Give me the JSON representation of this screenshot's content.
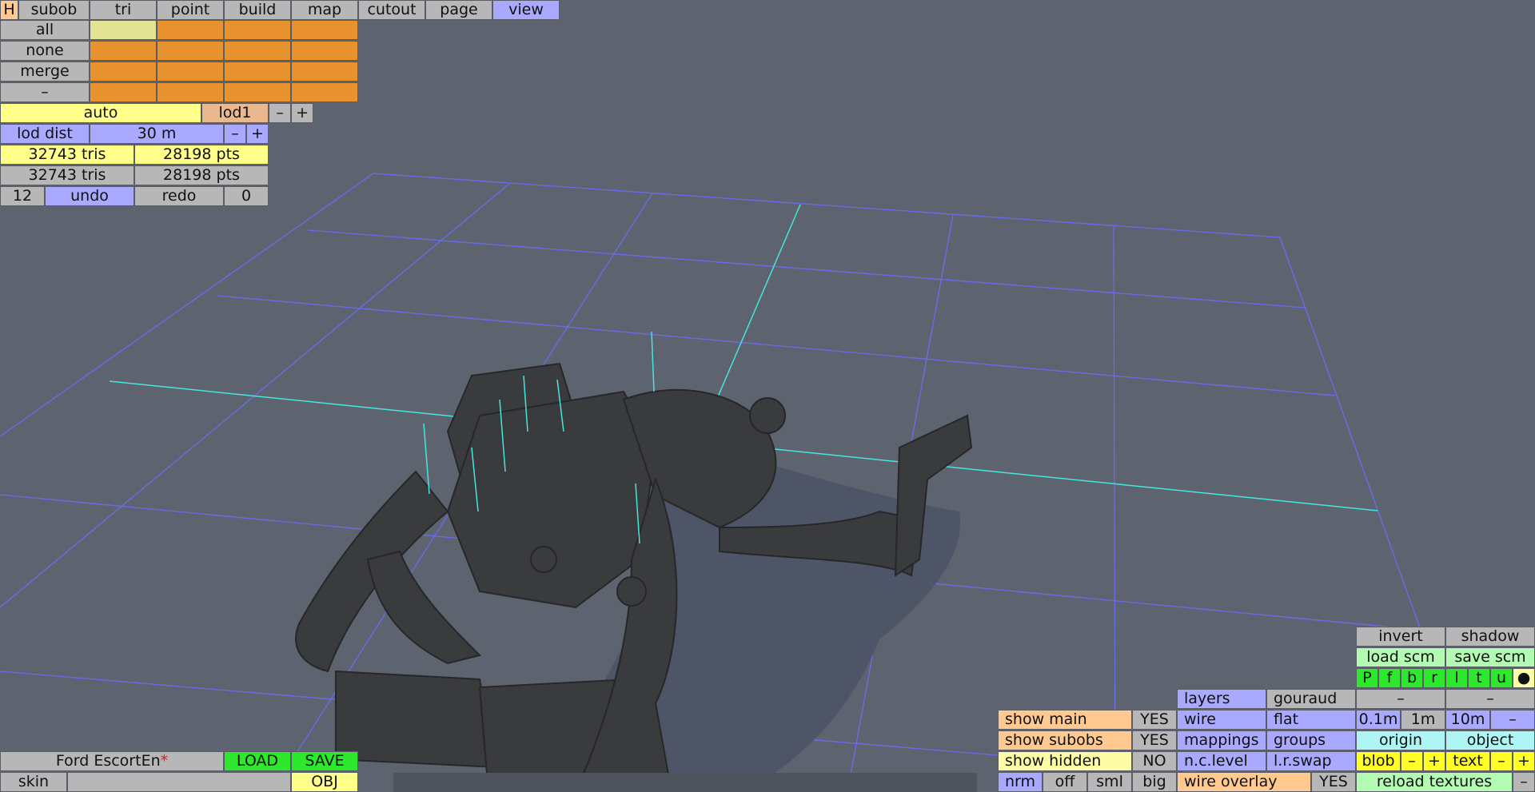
{
  "menu": {
    "home": "H",
    "tabs": [
      "subob",
      "tri",
      "point",
      "build",
      "map",
      "cutout",
      "page",
      "view"
    ],
    "active_tab": "view"
  },
  "selection": {
    "rows": [
      "all",
      "none",
      "merge",
      "–"
    ]
  },
  "lod": {
    "mode": "auto",
    "level": "lod1",
    "minus": "–",
    "plus": "+",
    "dist_label": "lod dist",
    "dist_value": "30 m"
  },
  "stats": {
    "visible_tris": "32743 tris",
    "visible_pts": "28198 pts",
    "total_tris": "32743 tris",
    "total_pts": "28198 pts"
  },
  "history": {
    "undo_count": "12",
    "undo": "undo",
    "redo": "redo",
    "redo_count": "0"
  },
  "file": {
    "name": "Ford EscortEn",
    "modified_mark": "*",
    "load": "LOAD",
    "save": "SAVE",
    "skin_label": "skin",
    "skin_value": "",
    "format": "OBJ"
  },
  "display": {
    "show_main": {
      "label": "show main",
      "value": "YES"
    },
    "show_subobs": {
      "label": "show subobs",
      "value": "YES"
    },
    "show_hidden": {
      "label": "show hidden",
      "value": "NO"
    },
    "normals": [
      "nrm",
      "off",
      "sml",
      "big"
    ],
    "wire_overlay": {
      "label": "wire overlay",
      "value": "YES"
    }
  },
  "render": {
    "layers": "layers",
    "gouraud": "gouraud",
    "wire": "wire",
    "flat": "flat",
    "mappings": "mappings",
    "groups": "groups",
    "nc_level": "n.c.level",
    "lr_swap": "l.r.swap"
  },
  "camera": {
    "invert": "invert",
    "shadow": "shadow",
    "load_scm": "load scm",
    "save_scm": "save scm",
    "views": [
      "P",
      "f",
      "b",
      "r",
      "l",
      "t",
      "u",
      "●"
    ],
    "dash_a": "–",
    "dash_b": "–",
    "grid": [
      "0.1m",
      "1m",
      "10m",
      "–"
    ],
    "origin": "origin",
    "object": "object",
    "blob": "blob",
    "blob_minus": "–",
    "blob_plus": "+",
    "text": "text",
    "text_minus": "–",
    "text_plus": "+",
    "reload_textures": "reload textures",
    "reload_dash": "–"
  }
}
